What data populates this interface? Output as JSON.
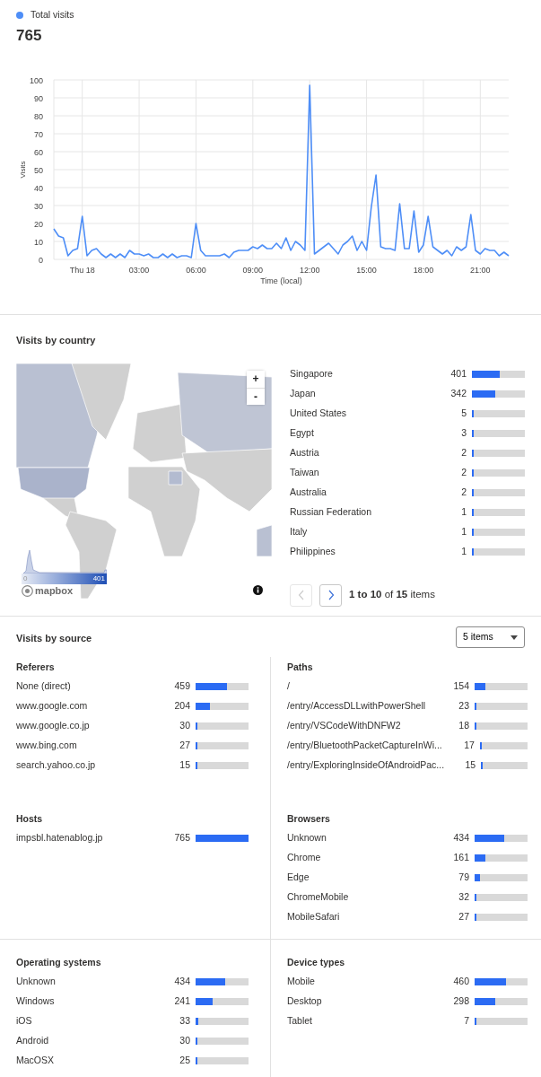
{
  "summary": {
    "total": "765"
  },
  "chart_data": {
    "type": "line",
    "xlabel": "Time (local)",
    "ylabel": "Visits",
    "x": [
      -1.5,
      -1.25,
      -1,
      -0.75,
      -0.5,
      -0.25,
      0,
      0.25,
      0.5,
      0.75,
      1,
      1.25,
      1.5,
      1.75,
      2,
      2.25,
      2.5,
      2.75,
      3,
      3.25,
      3.5,
      3.75,
      4,
      4.25,
      4.5,
      4.75,
      5,
      5.25,
      5.5,
      5.75,
      6,
      6.25,
      6.5,
      6.75,
      7,
      7.25,
      7.5,
      7.75,
      8,
      8.25,
      8.5,
      8.75,
      9,
      9.25,
      9.5,
      9.75,
      10,
      10.25,
      10.5,
      10.75,
      11,
      11.25,
      11.5,
      11.75,
      12,
      12.25,
      12.5,
      12.75,
      13,
      13.25,
      13.5,
      13.75,
      14,
      14.25,
      14.5,
      14.75,
      15,
      15.25,
      15.5,
      15.75,
      16,
      16.25,
      16.5,
      16.75,
      17,
      17.25,
      17.5,
      17.75,
      18,
      18.25,
      18.5,
      18.75,
      19,
      19.25,
      19.5,
      19.75,
      20,
      20.25,
      20.5,
      20.75,
      21,
      21.25,
      21.5,
      21.75,
      22,
      22.25,
      22.5
    ],
    "series": [
      {
        "name": "Total visits",
        "color": "#4e8ef7",
        "values": [
          17,
          13,
          12,
          2,
          5,
          6,
          24,
          2,
          5,
          6,
          3,
          1,
          3,
          1,
          3,
          1,
          5,
          3,
          3,
          2,
          3,
          1,
          1,
          3,
          1,
          3,
          1,
          2,
          2,
          1,
          20,
          5,
          2,
          2,
          2,
          2,
          3,
          1,
          4,
          5,
          5,
          5,
          7,
          6,
          8,
          6,
          6,
          9,
          6,
          12,
          5,
          10,
          8,
          5,
          97,
          3,
          5,
          7,
          9,
          6,
          3,
          8,
          10,
          13,
          5,
          10,
          5,
          29,
          47,
          7,
          6,
          6,
          5,
          31,
          6,
          6,
          27,
          4,
          8,
          24,
          7,
          5,
          3,
          5,
          2,
          7,
          5,
          7,
          25,
          5,
          3,
          6,
          5,
          5,
          2,
          4,
          2
        ]
      }
    ],
    "xlim": [
      -1.5,
      22.5
    ],
    "ylim": [
      0,
      100
    ],
    "xticks": [
      {
        "value": 0,
        "label": "Thu 18"
      },
      {
        "value": 3,
        "label": "03:00"
      },
      {
        "value": 6,
        "label": "06:00"
      },
      {
        "value": 9,
        "label": "09:00"
      },
      {
        "value": 12,
        "label": "12:00"
      },
      {
        "value": 15,
        "label": "15:00"
      },
      {
        "value": 18,
        "label": "18:00"
      },
      {
        "value": 21,
        "label": "21:00"
      }
    ],
    "yticks": [
      0,
      10,
      20,
      30,
      40,
      50,
      60,
      70,
      80,
      90,
      100
    ],
    "grid": true
  },
  "country": {
    "title": "Visits by country",
    "map": {
      "zoom_in": "+",
      "zoom_out": "-",
      "scale_min": "0",
      "scale_max": "401",
      "logo": "mapbox"
    },
    "rows": [
      {
        "name": "Singapore",
        "count": "401",
        "level": 0.524
      },
      {
        "name": "Japan",
        "count": "342",
        "level": 0.447
      },
      {
        "name": "United States",
        "count": "5",
        "level": 0.007
      },
      {
        "name": "Egypt",
        "count": "3",
        "level": 0.004
      },
      {
        "name": "Austria",
        "count": "2",
        "level": 0.003
      },
      {
        "name": "Taiwan",
        "count": "2",
        "level": 0.003
      },
      {
        "name": "Australia",
        "count": "2",
        "level": 0.003
      },
      {
        "name": "Russian Federation",
        "count": "1",
        "level": 0.001
      },
      {
        "name": "Italy",
        "count": "1",
        "level": 0.001
      },
      {
        "name": "Philippines",
        "count": "1",
        "level": 0.001
      }
    ],
    "pagination": {
      "prev_disabled": true,
      "next_disabled": false,
      "summary": "**1 to 10** of **15** items"
    }
  },
  "source": {
    "title": "Visits by source",
    "dropdown": "5 items",
    "groups": [
      {
        "title": "Referers",
        "rows": [
          {
            "name": "None (direct)",
            "count": "459",
            "level": 0.6
          },
          {
            "name": "www.google.com",
            "count": "204",
            "level": 0.267
          },
          {
            "name": "www.google.co.jp",
            "count": "30",
            "level": 0.039
          },
          {
            "name": "www.bing.com",
            "count": "27",
            "level": 0.035
          },
          {
            "name": "search.yahoo.co.jp",
            "count": "15",
            "level": 0.02
          }
        ]
      },
      {
        "title": "Paths",
        "rows": [
          {
            "name": "/",
            "count": "154",
            "level": 0.201
          },
          {
            "name": "/entry/AccessDLLwithPowerShell",
            "count": "23",
            "level": 0.03
          },
          {
            "name": "/entry/VSCodeWithDNFW2",
            "count": "18",
            "level": 0.024
          },
          {
            "name": "/entry/BluetoothPacketCaptureInWi...",
            "count": "17",
            "level": 0.022
          },
          {
            "name": "/entry/ExploringInsideOfAndroidPac...",
            "count": "15",
            "level": 0.02
          }
        ]
      },
      {
        "title": "Hosts",
        "rows": [
          {
            "name": "impsbl.hatenablog.jp",
            "count": "765",
            "level": 1
          }
        ]
      },
      {
        "title": "Browsers",
        "rows": [
          {
            "name": "Unknown",
            "count": "434",
            "level": 0.567
          },
          {
            "name": "Chrome",
            "count": "161",
            "level": 0.21
          },
          {
            "name": "Edge",
            "count": "79",
            "level": 0.103
          },
          {
            "name": "ChromeMobile",
            "count": "32",
            "level": 0.042
          },
          {
            "name": "MobileSafari",
            "count": "27",
            "level": 0.035
          }
        ]
      },
      {
        "title": "Operating systems",
        "rows": [
          {
            "name": "Unknown",
            "count": "434",
            "level": 0.567
          },
          {
            "name": "Windows",
            "count": "241",
            "level": 0.315
          },
          {
            "name": "iOS",
            "count": "33",
            "level": 0.043
          },
          {
            "name": "Android",
            "count": "30",
            "level": 0.039
          },
          {
            "name": "MacOSX",
            "count": "25",
            "level": 0.033
          }
        ]
      },
      {
        "title": "Device types",
        "rows": [
          {
            "name": "Mobile",
            "count": "460",
            "level": 0.601
          },
          {
            "name": "Desktop",
            "count": "298",
            "level": 0.39
          },
          {
            "name": "Tablet",
            "count": "7",
            "level": 0.009
          }
        ]
      }
    ]
  }
}
